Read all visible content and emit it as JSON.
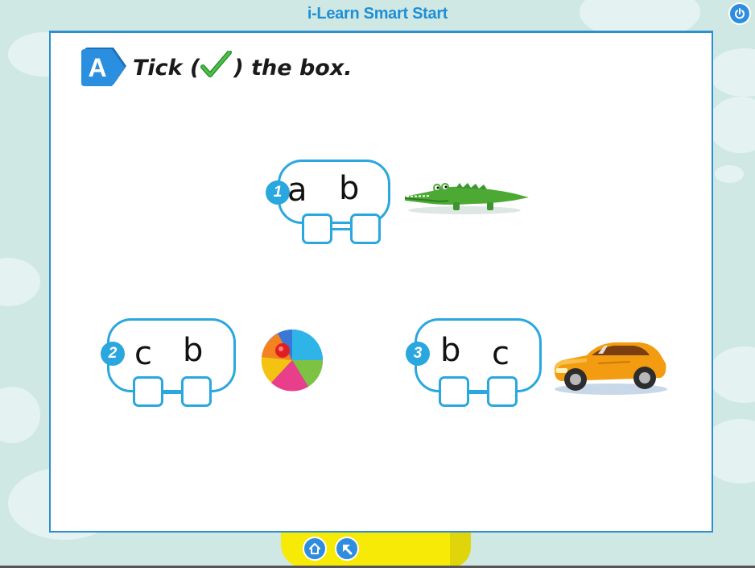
{
  "app": {
    "title": "i-Learn Smart Start"
  },
  "activity": {
    "section_letter": "A",
    "instruction_before": "Tick (",
    "instruction_after": ") the box.",
    "items": [
      {
        "number": "1",
        "letters": [
          "a",
          "b"
        ],
        "picture": "crocodile"
      },
      {
        "number": "2",
        "letters": [
          "c",
          "b"
        ],
        "picture": "ball"
      },
      {
        "number": "3",
        "letters": [
          "b",
          "c"
        ],
        "picture": "car"
      }
    ]
  },
  "nav": {
    "home_icon": "home-icon",
    "back_icon": "back-arrow-icon",
    "power_icon": "power-icon"
  },
  "colors": {
    "accent": "#2aa7df",
    "frame": "#2e8fd0",
    "bar": "#f6ea06",
    "background": "#cfe8e4"
  }
}
